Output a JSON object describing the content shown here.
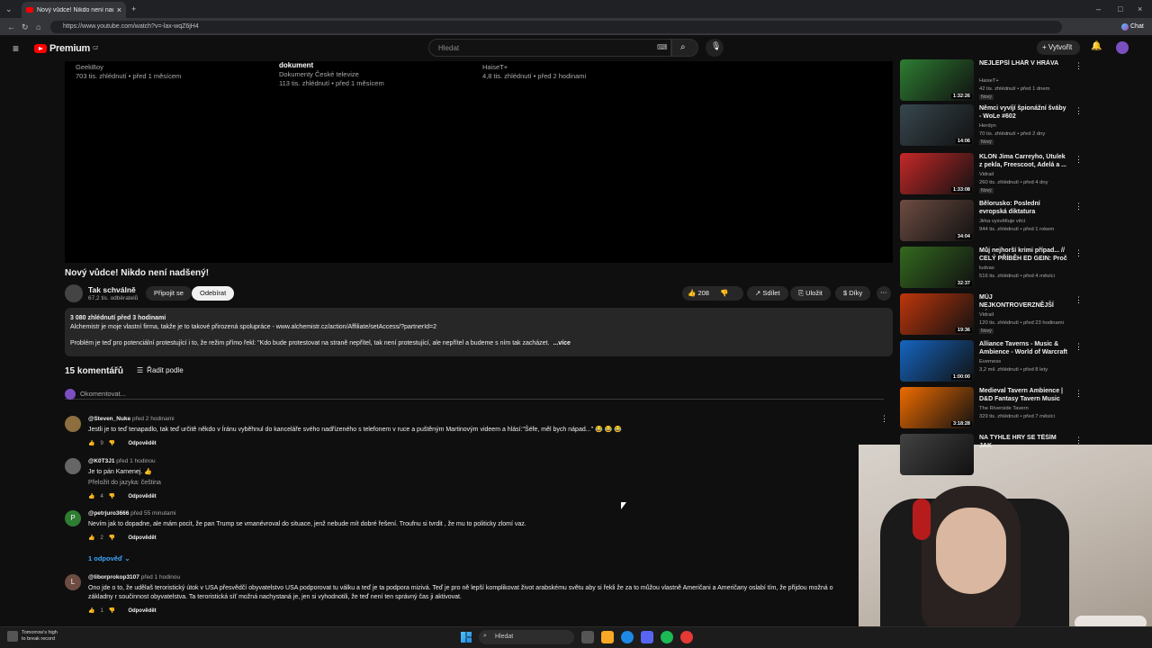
{
  "browser": {
    "tab_title": "Nový vůdce! Nikdo není nadšený! - YouTube",
    "url": "https://www.youtube.com/watch?v=-lax-wqZ6jH4",
    "chat_label": "Chat"
  },
  "header": {
    "logo": "Premium",
    "region": "CZ",
    "search_placeholder": "Hledat",
    "create_label": "Vytvořit"
  },
  "endcards": [
    {
      "title": "",
      "channel": "GeekBoy",
      "meta": "703 tis. zhlédnutí • před 1 měsícem"
    },
    {
      "title": "dokument",
      "channel": "Dokumenty České televize",
      "meta": "113 tis. zhlédnutí • před 1 měsícem"
    },
    {
      "title": "",
      "channel": "HaiseT+",
      "meta": "4,8 tis. zhlédnutí • před 2 hodinami"
    }
  ],
  "video": {
    "title": "Nový vůdce! Nikdo není nadšený!",
    "channel": "Tak schválně",
    "subscribers": "67,2 tis. odběratelů",
    "join": "Připojit se",
    "subscribe": "Odebírat",
    "likes": "208",
    "share": "Sdílet",
    "save": "Uložit",
    "thanks": "Díky"
  },
  "description": {
    "meta": "3 080 zhlédnutí  před 3 hodinami",
    "line1": "Alchemistr je moje vlastní firma, takže je to takové přirozená spolupráce - www.alchemistr.cz/action/Affiliate/setAccess/?partnerId=2",
    "line2": "Problém je teď pro potenciální protestující i to, že režim přímo řekl: \"Kdo bude protestovat na straně nepřítel, tak není protestující, ale nepřítel a budeme s ním tak zacházet.",
    "more": "...více"
  },
  "comments_section": {
    "count": "15 komentářů",
    "sort": "Řadit podle",
    "add_placeholder": "Okomentovat...",
    "reply_label": "Odpovědět",
    "replies_toggle": "1 odpověď"
  },
  "comments": [
    {
      "author": "@Steven_Nuke",
      "time": "před 2 hodinami",
      "text": "Jestli je to teď tenapadlo, tak teď určitě někdo v Íránu vyběhnul do kanceláře svého nadřízeného s telefonem v ruce a puštěným Martinovým videem a hlásí:\"Šéfe, měl bych nápad...\" 😂 😂 😂",
      "likes": "9"
    },
    {
      "author": "@K0T3J1",
      "time": "před 1 hodinou",
      "text": "Je to pán Kamenej. 👍",
      "translate": "Přeložit do jazyka: čeština",
      "likes": "4"
    },
    {
      "author": "@petrjuro3666",
      "time": "před 55 minutami",
      "text": "Nevím jak to dopadne, ale mám pocit, že pan Trump se vmanévroval do situace, jenž nebude mít dobré řešení. Troufnu si tvrdit , že mu to politicky zlomí vaz.",
      "likes": "2"
    },
    {
      "author": "@liborprokop3107",
      "time": "před 1 hodinou",
      "text": "Ono jde o to, že udělaš teroristický útok v USA přesvědčí obyvatelstvo USA podporovat tu válku a teď je ta podpora mizivá. Teď je pro ně lepší komplikovat život arabskému světu aby si řekli že za to můžou vlastně Američani a Američany oslabí tím, že přijdou možná o základny r součinnost obyvatelstva. Ta teroristická síť možná nachystaná je, jen si vyhodnotili, že teď není ten správný čas ji aktivovat.",
      "likes": "1"
    }
  ],
  "recommendations": [
    {
      "title": "NEJLEPŠÍ LHÁŘ V HRÁVA",
      "channel": "HaiseT+",
      "meta": "42 tis. zhlédnutí • před 1 dnem",
      "duration": "1:32:26",
      "new": "Nový",
      "color": "#2e7d32"
    },
    {
      "title": "Němci vyvíjí špionážní šváby - WoLe #602",
      "channel": "Herdyn",
      "meta": "70 tis. zhlédnutí • před 2 dny",
      "duration": "14:06",
      "new": "Nový",
      "color": "#37474f"
    },
    {
      "title": "KLON Jima Carreyho, Útulek z pekla, Freescoot, Adelá a ...",
      "channel": "Vidrail",
      "meta": "260 tis. zhlédnutí • před 4 dny",
      "duration": "1:33:08",
      "new": "Nový",
      "color": "#c62828"
    },
    {
      "title": "Bělorusko: Poslední evropská diktatura",
      "channel": "Jirka vysvětluje věci",
      "meta": "944 tis. zhlédnutí • před 1 rokem",
      "duration": "34:04",
      "new": "",
      "color": "#6d4c41"
    },
    {
      "title": "Můj nejhorší krimi případ... // CELÝ PŘÍBĚH ED GEIN: Proč to...",
      "channel": "ludvas",
      "meta": "516 tis. zhlédnutí • před 4 měsíci",
      "duration": "32:37",
      "new": "",
      "color": "#33691e"
    },
    {
      "title": "MŮJ NEJKONTROVERZNĚJŠÍ NÁZOR! - ASQQQ",
      "channel": "Vidrail",
      "meta": "120 tis. zhlédnutí • před 23 hodinami",
      "duration": "19:36",
      "new": "Nový",
      "color": "#bf360c"
    },
    {
      "title": "Alliance Taverns - Music & Ambience - World of Warcraft",
      "channel": "Everness",
      "meta": "3,2 mil. zhlédnutí • před 8 lety",
      "duration": "1:00:00",
      "new": "",
      "color": "#1565c0"
    },
    {
      "title": "Medieval Tavern Ambience | D&D Fantasy Tavern Music an...",
      "channel": "The Riverside Tavern",
      "meta": "329 tis. zhlédnutí • před 7 měsíci",
      "duration": "3:18:28",
      "new": "",
      "color": "#ef6c00"
    },
    {
      "title": "NA TYHLE HRY SE TĚŠÍM JAK",
      "channel": "",
      "meta": "",
      "duration": "",
      "new": "",
      "color": "#424242"
    }
  ],
  "taskbar": {
    "weather_line1": "Tomorrow's high",
    "weather_line2": "to break record",
    "search": "Hledat"
  }
}
